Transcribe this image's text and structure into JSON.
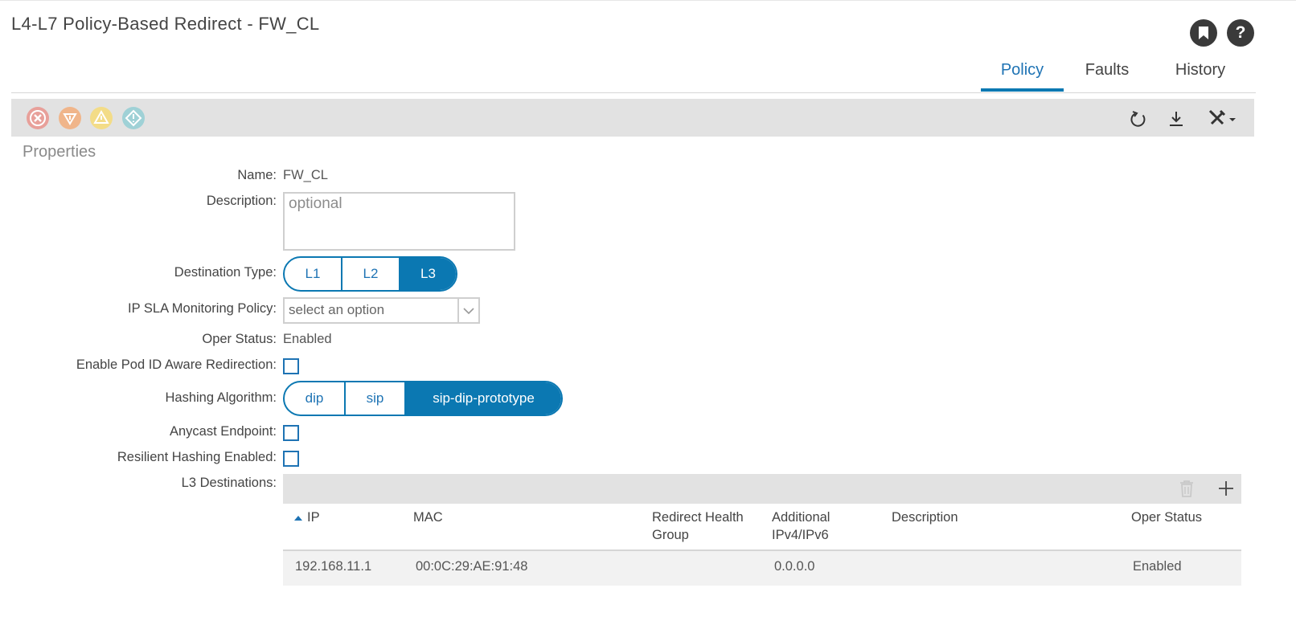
{
  "header": {
    "title": "L4-L7 Policy-Based Redirect - FW_CL",
    "help_glyph": "?"
  },
  "tabs": [
    {
      "label": "Policy",
      "active": true
    },
    {
      "label": "Faults",
      "active": false
    },
    {
      "label": "History",
      "active": false
    }
  ],
  "toolbar": {
    "fault_icons": [
      "critical-fault-icon",
      "major-fault-icon",
      "minor-fault-icon",
      "warning-fault-icon"
    ],
    "actions": [
      "refresh-icon",
      "download-icon",
      "tools-icon"
    ]
  },
  "section": {
    "title": "Properties"
  },
  "form": {
    "name_label": "Name:",
    "name_value": "FW_CL",
    "description_label": "Description:",
    "description_placeholder": "optional",
    "destination_type_label": "Destination Type:",
    "destination_type_options": [
      "L1",
      "L2",
      "L3"
    ],
    "destination_type_selected": "L3",
    "ip_sla_label": "IP SLA Monitoring Policy:",
    "ip_sla_value": "select an option",
    "oper_status_label": "Oper Status:",
    "oper_status_value": "Enabled",
    "pod_aware_label": "Enable Pod ID Aware Redirection:",
    "pod_aware_checked": false,
    "hashing_label": "Hashing Algorithm:",
    "hashing_options": [
      "dip",
      "sip",
      "sip-dip-prototype"
    ],
    "hashing_selected": "sip-dip-prototype",
    "anycast_label": "Anycast Endpoint:",
    "anycast_checked": false,
    "resilient_label": "Resilient Hashing Enabled:",
    "resilient_checked": false,
    "l3_dest_label": "L3 Destinations:"
  },
  "l3_destinations": {
    "columns": [
      "IP",
      "MAC",
      "Redirect Health Group",
      "Additional IPv4/IPv6",
      "Description",
      "Oper Status"
    ],
    "sort_column": "IP",
    "rows": [
      {
        "ip": "192.168.11.1",
        "mac": "00:0C:29:AE:91:48",
        "health_group": "",
        "additional_ip": "0.0.0.0",
        "description": "",
        "oper_status": "Enabled"
      }
    ]
  },
  "colors": {
    "accent": "#0b78b2",
    "critical": "#e8a09a",
    "major": "#f0b58a",
    "minor": "#f3dc87",
    "warning": "#9fd1d6"
  }
}
